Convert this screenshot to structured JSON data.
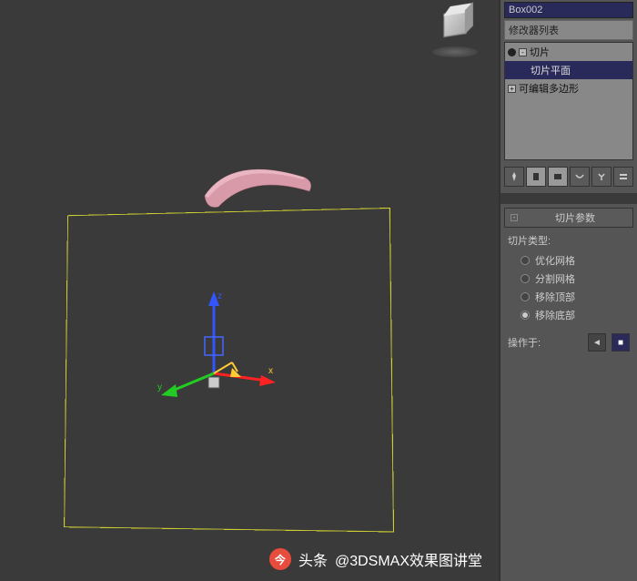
{
  "object_name": "Box002",
  "modifier_list_label": "修改器列表",
  "modifier_stack": {
    "slice_modifier": "切片",
    "slice_plane": "切片平面",
    "base_object": "可编辑多边形"
  },
  "rollup": {
    "title": "切片参数",
    "type_label": "切片类型:",
    "options": {
      "refine": "优化网格",
      "split": "分割网格",
      "remove_top": "移除顶部",
      "remove_bottom": "移除底部"
    },
    "operate_on": "操作于:"
  },
  "watermark": {
    "prefix": "头条",
    "handle": "@3DSMAX效果图讲堂"
  },
  "icons": {
    "minus": "-",
    "plus": "+",
    "expand_minus": "⊟",
    "expand_plus": "⊞",
    "tri_left": "◄",
    "square": "■"
  }
}
